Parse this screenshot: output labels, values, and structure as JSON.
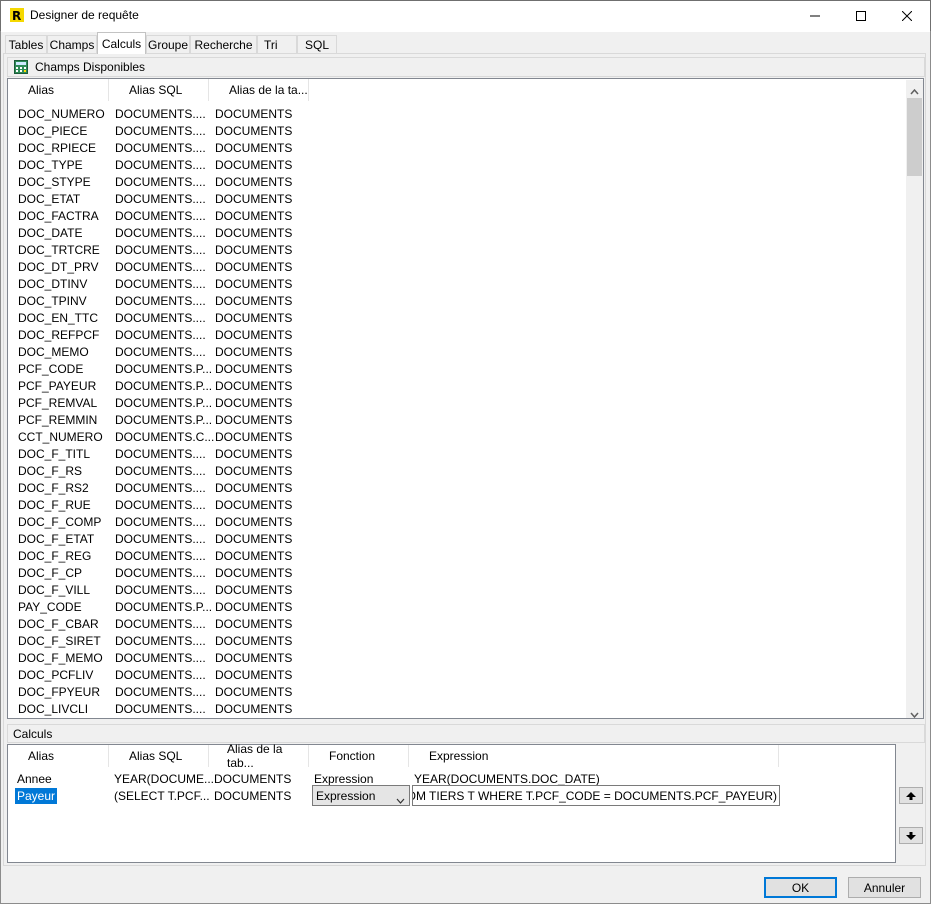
{
  "window": {
    "title": "Designer de requête"
  },
  "tabs": [
    "Tables",
    "Champs",
    "Calculs",
    "Groupe",
    "Recherche",
    "Tri",
    "SQL"
  ],
  "available": {
    "header": "Champs Disponibles",
    "columns": [
      "Alias",
      "Alias SQL",
      "Alias de la ta..."
    ],
    "rows": [
      [
        "DOC_NUMERO",
        "DOCUMENTS....",
        "DOCUMENTS"
      ],
      [
        "DOC_PIECE",
        "DOCUMENTS....",
        "DOCUMENTS"
      ],
      [
        "DOC_RPIECE",
        "DOCUMENTS....",
        "DOCUMENTS"
      ],
      [
        "DOC_TYPE",
        "DOCUMENTS....",
        "DOCUMENTS"
      ],
      [
        "DOC_STYPE",
        "DOCUMENTS....",
        "DOCUMENTS"
      ],
      [
        "DOC_ETAT",
        "DOCUMENTS....",
        "DOCUMENTS"
      ],
      [
        "DOC_FACTRA",
        "DOCUMENTS....",
        "DOCUMENTS"
      ],
      [
        "DOC_DATE",
        "DOCUMENTS....",
        "DOCUMENTS"
      ],
      [
        "DOC_TRTCRE",
        "DOCUMENTS....",
        "DOCUMENTS"
      ],
      [
        "DOC_DT_PRV",
        "DOCUMENTS....",
        "DOCUMENTS"
      ],
      [
        "DOC_DTINV",
        "DOCUMENTS....",
        "DOCUMENTS"
      ],
      [
        "DOC_TPINV",
        "DOCUMENTS....",
        "DOCUMENTS"
      ],
      [
        "DOC_EN_TTC",
        "DOCUMENTS....",
        "DOCUMENTS"
      ],
      [
        "DOC_REFPCF",
        "DOCUMENTS....",
        "DOCUMENTS"
      ],
      [
        "DOC_MEMO",
        "DOCUMENTS....",
        "DOCUMENTS"
      ],
      [
        "PCF_CODE",
        "DOCUMENTS.P...",
        "DOCUMENTS"
      ],
      [
        "PCF_PAYEUR",
        "DOCUMENTS.P...",
        "DOCUMENTS"
      ],
      [
        "PCF_REMVAL",
        "DOCUMENTS.P...",
        "DOCUMENTS"
      ],
      [
        "PCF_REMMIN",
        "DOCUMENTS.P...",
        "DOCUMENTS"
      ],
      [
        "CCT_NUMERO",
        "DOCUMENTS.C...",
        "DOCUMENTS"
      ],
      [
        "DOC_F_TITL",
        "DOCUMENTS....",
        "DOCUMENTS"
      ],
      [
        "DOC_F_RS",
        "DOCUMENTS....",
        "DOCUMENTS"
      ],
      [
        "DOC_F_RS2",
        "DOCUMENTS....",
        "DOCUMENTS"
      ],
      [
        "DOC_F_RUE",
        "DOCUMENTS....",
        "DOCUMENTS"
      ],
      [
        "DOC_F_COMP",
        "DOCUMENTS....",
        "DOCUMENTS"
      ],
      [
        "DOC_F_ETAT",
        "DOCUMENTS....",
        "DOCUMENTS"
      ],
      [
        "DOC_F_REG",
        "DOCUMENTS....",
        "DOCUMENTS"
      ],
      [
        "DOC_F_CP",
        "DOCUMENTS....",
        "DOCUMENTS"
      ],
      [
        "DOC_F_VILL",
        "DOCUMENTS....",
        "DOCUMENTS"
      ],
      [
        "PAY_CODE",
        "DOCUMENTS.P...",
        "DOCUMENTS"
      ],
      [
        "DOC_F_CBAR",
        "DOCUMENTS....",
        "DOCUMENTS"
      ],
      [
        "DOC_F_SIRET",
        "DOCUMENTS....",
        "DOCUMENTS"
      ],
      [
        "DOC_F_MEMO",
        "DOCUMENTS....",
        "DOCUMENTS"
      ],
      [
        "DOC_PCFLIV",
        "DOCUMENTS....",
        "DOCUMENTS"
      ],
      [
        "DOC_FPYEUR",
        "DOCUMENTS....",
        "DOCUMENTS"
      ],
      [
        "DOC_LIVCLI",
        "DOCUMENTS....",
        "DOCUMENTS"
      ]
    ]
  },
  "calculs": {
    "header": "Calculs",
    "columns": [
      "Alias",
      "Alias SQL",
      "Alias de la tab...",
      "Fonction",
      "Expression"
    ],
    "rows": [
      {
        "alias": "Annee",
        "alias_sql": "YEAR(DOCUME...",
        "table": "DOCUMENTS",
        "fonction": "Expression",
        "expression": "YEAR(DOCUMENTS.DOC_DATE)"
      },
      {
        "alias": "Payeur",
        "alias_sql": "(SELECT T.PCF...",
        "table": "DOCUMENTS",
        "fonction": "Expression",
        "expression": "RS FROM TIERS T WHERE T.PCF_CODE = DOCUMENTS.PCF_PAYEUR)"
      }
    ]
  },
  "buttons": {
    "ok": "OK",
    "cancel": "Annuler"
  },
  "icons": {
    "up": "arrow-up-icon",
    "down": "arrow-down-icon"
  }
}
